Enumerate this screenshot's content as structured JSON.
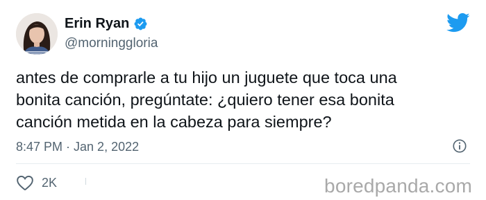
{
  "author": {
    "name": "Erin Ryan",
    "handle": "@morninggloria",
    "verified": true
  },
  "tweet": {
    "text": "antes de comprarle a tu hijo un juguete que toca una\nbonita canción, pregúntate: ¿quiero tener esa bonita\ncanción metida en la cabeza para siempre?",
    "timestamp": "8:47 PM · Jan 2, 2022"
  },
  "actions": {
    "like_count": "2K"
  },
  "icons": {
    "verified": "verified-badge-icon",
    "brand": "twitter-bird-icon",
    "info": "info-icon",
    "like": "heart-icon"
  },
  "colors": {
    "brand_blue": "#1d9bf0",
    "text_primary": "#0f1419",
    "text_secondary": "#536471",
    "watermark": "#a9a9a9"
  },
  "watermark": "boredpanda.com"
}
